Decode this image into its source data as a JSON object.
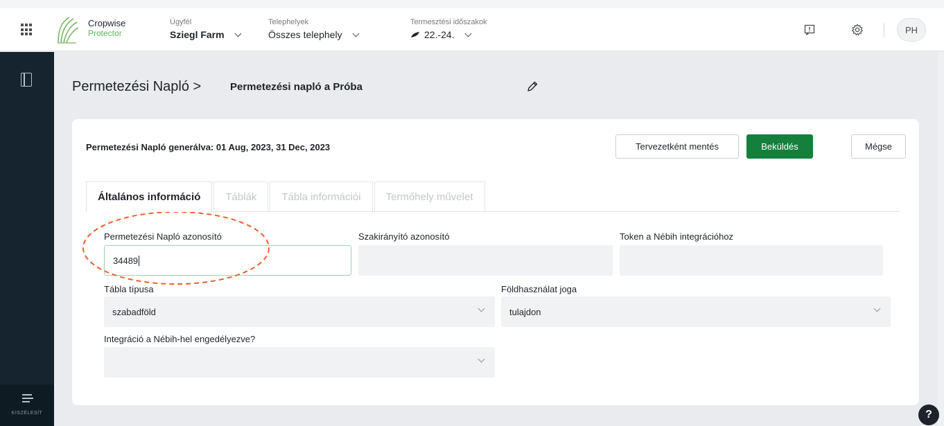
{
  "header": {
    "brand_line1": "Cropwise",
    "brand_line2": "Protector",
    "client": {
      "label": "Ügyfél",
      "value": "Sziegl Farm"
    },
    "sites": {
      "label": "Telephelyek",
      "value": "Összes telephely"
    },
    "seasons": {
      "label": "Termesztési időszakok",
      "value": "22.-24."
    },
    "avatar_initials": "PH"
  },
  "sidebar": {
    "expand_label": "KISZÉLESÍT"
  },
  "breadcrumb": {
    "root": "Permetezési Napló >",
    "current": "Permetezési napló a  Próba"
  },
  "card": {
    "generated_text": "Permetezési Napló generálva: 01 Aug, 2023, 31 Dec, 2023",
    "buttons": {
      "save_draft": "Tervezetként mentés",
      "submit": "Beküldés",
      "cancel": "Mégse"
    },
    "tabs": [
      {
        "label": "Általános információ",
        "active": true
      },
      {
        "label": "Táblák",
        "active": false
      },
      {
        "label": "Tábla információi",
        "active": false
      },
      {
        "label": "Termőhely művelet",
        "active": false
      }
    ],
    "fields": {
      "log_id": {
        "label": "Permetezési Napló azonosító",
        "value": "34489"
      },
      "advisor_id": {
        "label": "Szakirányító azonosító",
        "value": ""
      },
      "nebih_token": {
        "label": "Token a Nébih integrációhoz",
        "value": ""
      },
      "field_type": {
        "label": "Tábla típusa",
        "value": "szabadföld"
      },
      "land_use": {
        "label": "Földhasználat joga",
        "value": "tulajdon"
      },
      "nebih_enabled": {
        "label": "Integráció a Nébih-hel engedélyezve?",
        "value": ""
      }
    }
  },
  "help_label": "?",
  "colors": {
    "accent_green": "#14803c",
    "sidebar": "#15242f",
    "annotation": "#e8602c"
  }
}
